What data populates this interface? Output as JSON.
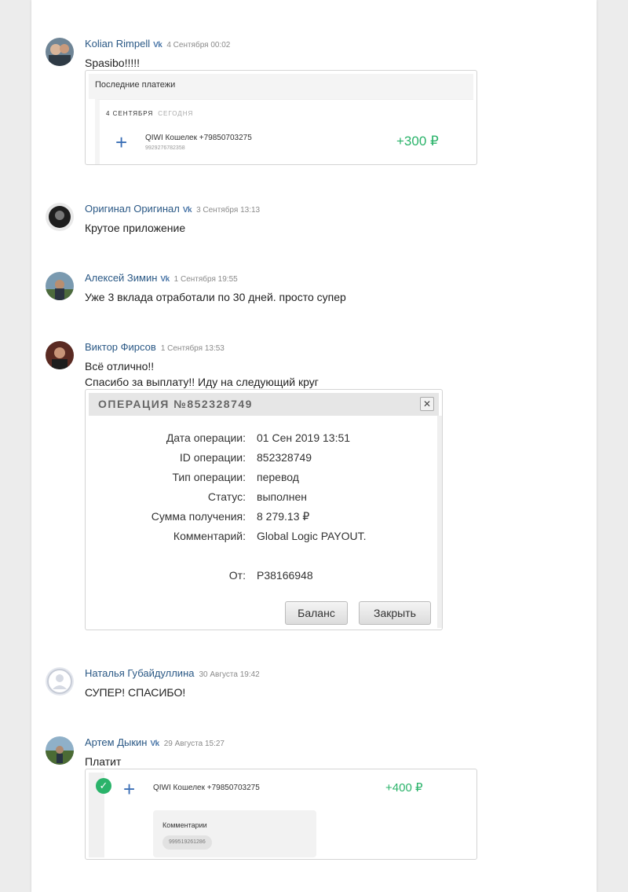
{
  "reviews": [
    {
      "name": "Kolian Rimpell",
      "date": "4 Сентября 00:02",
      "text": "Spasibo!!!!!",
      "vk": true
    },
    {
      "name": "Оригинал Оригинал",
      "date": "3 Сентября 13:13",
      "text": "Крутое приложение",
      "vk": true
    },
    {
      "name": "Алексей Зимин",
      "date": "1 Сентября 19:55",
      "text": "Уже 3 вклада отработали по 30 дней. просто супер",
      "vk": true
    },
    {
      "name": "Виктор Фирсов",
      "date": "1 Сентября 13:53",
      "text": "Всё отлично!!",
      "text2": "Спасибо за выплату!! Иду на следующий круг",
      "vk": false
    },
    {
      "name": "Наталья Губайдуллина",
      "date": "30 Августа 19:42",
      "text": "СУПЕР! СПАСИБО!",
      "vk": false
    },
    {
      "name": "Артем Дыкин",
      "date": "29 Августа 15:27",
      "text": "Платит",
      "vk": true
    }
  ],
  "vk_icon": "vk-icon",
  "qiwi1": {
    "header": "Последние платежи",
    "day": "4 СЕНТЯБРЯ",
    "today": "СЕГОДНЯ",
    "wallet": "QIWI Кошелек +79850703275",
    "sub": "9929276782358",
    "amount": "+300 ₽"
  },
  "operation": {
    "title": "ОПЕРАЦИЯ №852328749",
    "rows": [
      {
        "label": "Дата операции:",
        "value": "01 Сен 2019 13:51"
      },
      {
        "label": "ID операции:",
        "value": "852328749"
      },
      {
        "label": "Тип операции:",
        "value": "перевод"
      },
      {
        "label": "Статус:",
        "value": "выполнен"
      },
      {
        "label": "Сумма получения:",
        "value": "8 279.13 ₽"
      },
      {
        "label": "Комментарий:",
        "value": "Global Logic PAYOUT."
      },
      {
        "label": "От:",
        "value": "P38166948"
      }
    ],
    "balance_button": "Баланс",
    "close_button": "Закрыть"
  },
  "qiwi2": {
    "wallet": "QIWI Кошелек +79850703275",
    "amount": "+400 ₽",
    "comment_title": "Комментарии",
    "comment_value": "999519261286"
  },
  "colors": {
    "name": "#2a5885",
    "amount": "#2ab36a",
    "plus": "#3b6fb6"
  }
}
